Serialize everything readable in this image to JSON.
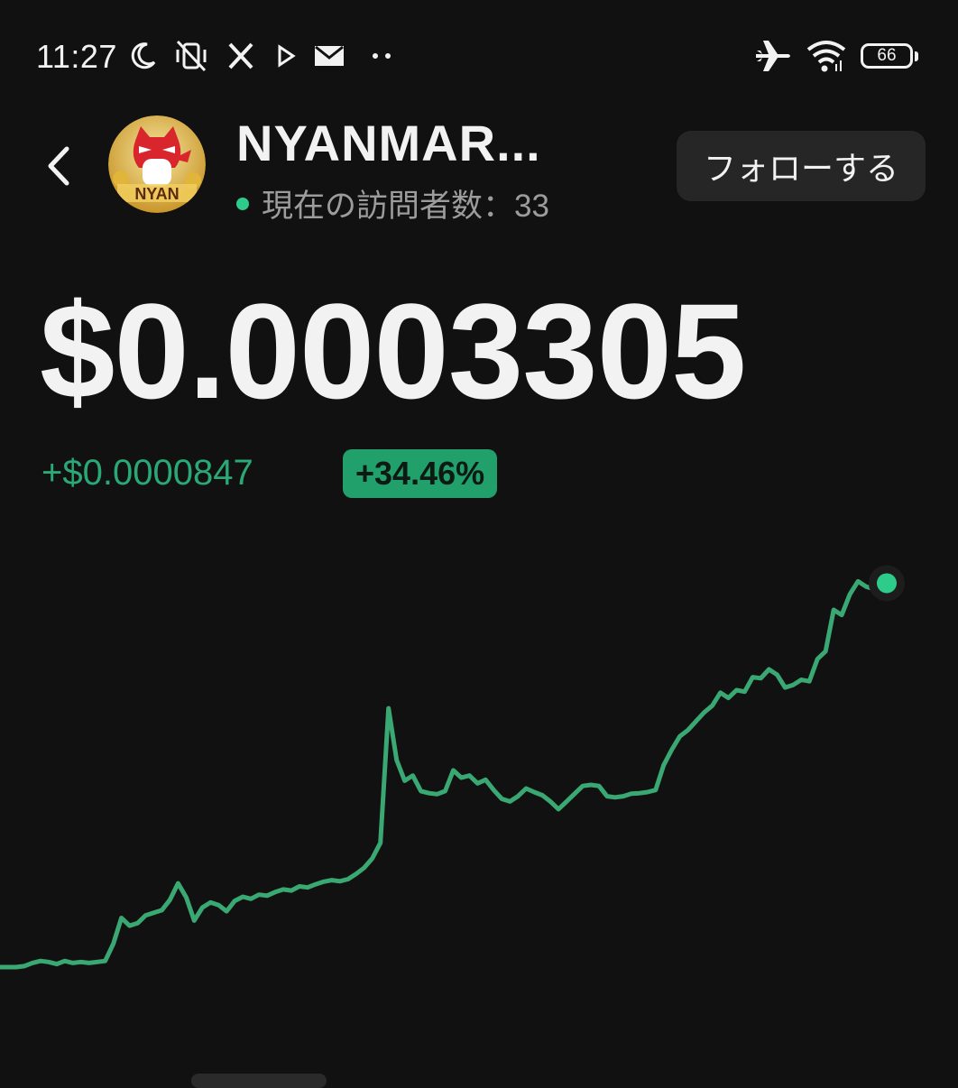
{
  "status_bar": {
    "time": "11:27",
    "battery": "66",
    "icons": [
      "moon-icon",
      "vibrate-off-icon",
      "x-app-icon",
      "play-icon",
      "mail-icon",
      "more-dots-icon",
      "airplane-icon",
      "wifi-icon",
      "battery-icon"
    ]
  },
  "header": {
    "back_icon": "chevron-left-icon",
    "token_name": "NYANMAR...",
    "visitors_label": "現在の訪問者数：33",
    "follow_label": "フォローする",
    "avatar_text": "NYAN"
  },
  "price": {
    "current": "$0.0003305",
    "change_abs": "+$0.0000847",
    "change_pct": "+34.46%"
  },
  "colors": {
    "background": "#111111",
    "accent_green": "#2aa876",
    "badge_green": "#22a06b",
    "online_dot": "#2ecc8b",
    "line": "#3aa872"
  },
  "chart_data": {
    "type": "line",
    "title": "",
    "xlabel": "",
    "ylabel": "",
    "grid": false,
    "series": [
      {
        "values": [
          0.000246,
          0.000246,
          0.000246,
          0.0002462,
          0.0002468,
          0.0002472,
          0.000247,
          0.0002466,
          0.0002472,
          0.0002468,
          0.000247,
          0.0002468,
          0.000247,
          0.0002472,
          0.0002505,
          0.0002555,
          0.000254,
          0.0002545,
          0.000256,
          0.0002565,
          0.000257,
          0.000259,
          0.0002622,
          0.0002595,
          0.000255,
          0.0002575,
          0.0002585,
          0.000258,
          0.0002568,
          0.0002588,
          0.0002596,
          0.0002592,
          0.00026,
          0.0002598,
          0.0002605,
          0.000261,
          0.0002608,
          0.0002616,
          0.0002614,
          0.000262,
          0.0002625,
          0.0002628,
          0.0002626,
          0.000263,
          0.000264,
          0.0002652,
          0.000267,
          0.00027,
          0.000296,
          0.000286,
          0.000282,
          0.000283,
          0.00028,
          0.0002796,
          0.0002794,
          0.00028,
          0.000284,
          0.0002826,
          0.000283,
          0.0002815,
          0.0002822,
          0.0002802,
          0.0002785,
          0.000278,
          0.000279,
          0.0002805,
          0.0002798,
          0.0002792,
          0.000278,
          0.0002765,
          0.000278,
          0.0002795,
          0.000281,
          0.0002812,
          0.000281,
          0.000279,
          0.0002788,
          0.000279,
          0.0002795,
          0.0002796,
          0.0002798,
          0.0002802,
          0.000285,
          0.000288,
          0.0002906,
          0.0002918,
          0.0002935,
          0.0002952,
          0.0002965,
          0.000299,
          0.000298,
          0.0002995,
          0.0002992,
          0.000302,
          0.0003018,
          0.0003035,
          0.0003025,
          0.0003,
          0.0003005,
          0.0003015,
          0.0003012,
          0.0003055,
          0.000307,
          0.000315,
          0.000314,
          0.000318,
          0.0003205,
          0.0003195,
          0.000319,
          0.0003205
        ],
        "color": "#3aa872"
      }
    ]
  }
}
